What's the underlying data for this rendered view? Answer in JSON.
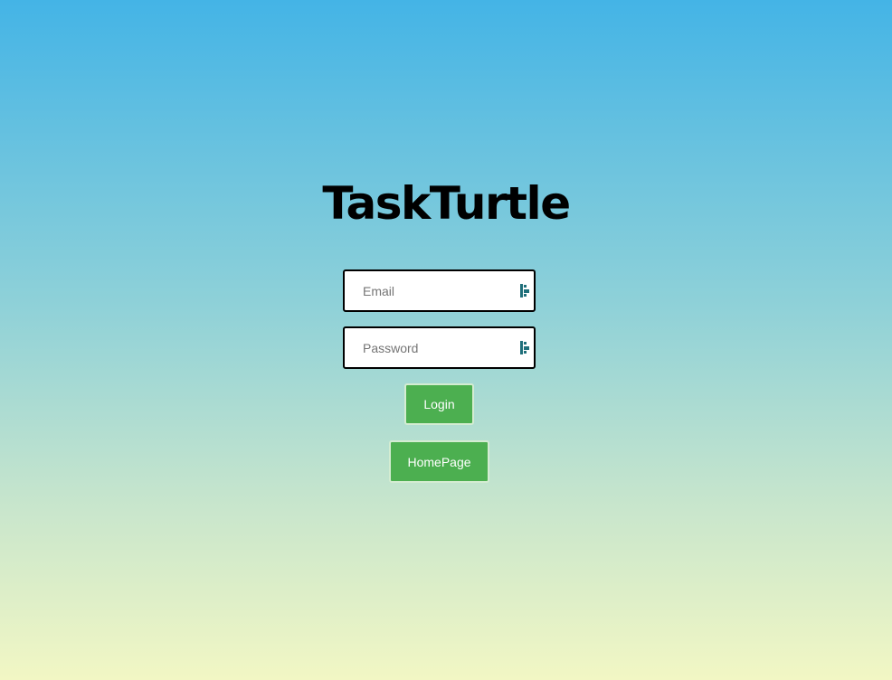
{
  "app": {
    "title": "TaskTurtle"
  },
  "form": {
    "email": {
      "placeholder": "Email",
      "value": ""
    },
    "password": {
      "placeholder": "Password",
      "value": ""
    }
  },
  "buttons": {
    "login_label": "Login",
    "homepage_label": "HomePage"
  },
  "icons": {
    "field_icon": "password-manager-icon"
  },
  "colors": {
    "gradient_top": "#44b4e6",
    "gradient_bottom": "#f2f7c4",
    "button_green": "#4caf50",
    "icon_teal": "#1f6f7a"
  }
}
